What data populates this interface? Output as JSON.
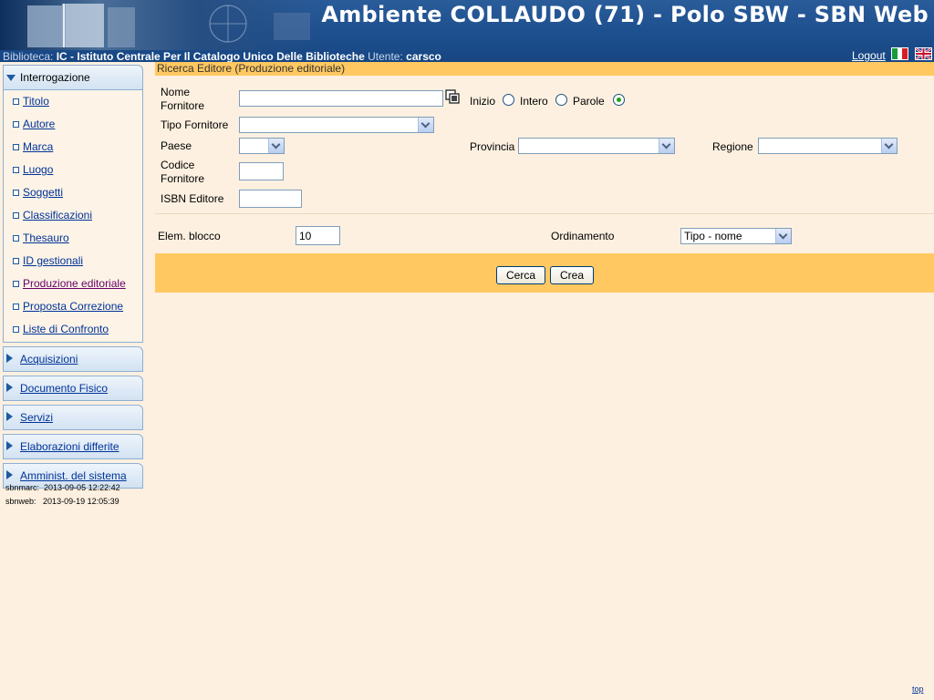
{
  "header": {
    "title": "Ambiente COLLAUDO (71) - Polo SBW - SBN Web",
    "library_label": "Biblioteca:",
    "library_value": "IC - Istituto Centrale Per Il Catalogo Unico Delle Biblioteche",
    "user_label": "Utente:",
    "user_value": "carsco",
    "logout_label": "Logout"
  },
  "sidebar": {
    "open_section": "Interrogazione",
    "open_items": [
      {
        "label": "Titolo"
      },
      {
        "label": "Autore"
      },
      {
        "label": "Marca"
      },
      {
        "label": "Luogo"
      },
      {
        "label": "Soggetti"
      },
      {
        "label": "Classificazioni"
      },
      {
        "label": "Thesauro"
      },
      {
        "label": "ID gestionali"
      },
      {
        "label": "Produzione editoriale",
        "active": true
      },
      {
        "label": "Proposta Correzione"
      },
      {
        "label": "Liste di Confronto"
      }
    ],
    "collapsed_sections": [
      {
        "label": "Acquisizioni"
      },
      {
        "label": "Documento Fisico"
      },
      {
        "label": "Servizi"
      },
      {
        "label": "Elaborazioni differite"
      },
      {
        "label": "Amminist. del sistema"
      }
    ],
    "versions": [
      {
        "label": "sbnmarc:",
        "value": "2013-09-05 12:22:42"
      },
      {
        "label": "sbnweb:",
        "value": "2013-09-19 12:05:39"
      }
    ]
  },
  "form": {
    "section_title": "Ricerca Editore (Produzione editoriale)",
    "nome_fornitore_label_1": "Nome",
    "nome_fornitore_label_2": "Fornitore",
    "nome_fornitore_value": "",
    "search_mode": {
      "inizio": "Inizio",
      "intero": "Intero",
      "parole": "Parole",
      "selected": "parole"
    },
    "tipo_fornitore_label": "Tipo Fornitore",
    "tipo_fornitore_value": "",
    "paese_label": "Paese",
    "paese_value": "",
    "provincia_label": "Provincia",
    "provincia_value": "",
    "regione_label": "Regione",
    "regione_value": "",
    "codice_fornitore_label_1": "Codice",
    "codice_fornitore_label_2": "Fornitore",
    "codice_fornitore_value": "",
    "isbn_editore_label": "ISBN Editore",
    "isbn_editore_value": "",
    "elem_blocco_label": "Elem. blocco",
    "elem_blocco_value": "10",
    "ordinamento_label": "Ordinamento",
    "ordinamento_value": "Tipo - nome"
  },
  "buttons": {
    "cerca": "Cerca",
    "crea": "Crea"
  },
  "footer": {
    "top_link": "top"
  },
  "colors": {
    "header_blue": "#1d4f8e",
    "page_bg": "#fdf0e0",
    "accent_orange": "#ffc860",
    "link_blue": "#003399"
  }
}
